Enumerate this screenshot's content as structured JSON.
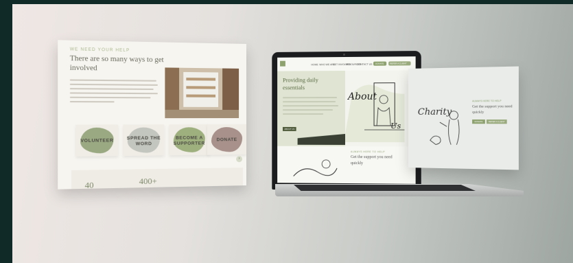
{
  "left_panel": {
    "kicker": "WE NEED YOUR HELP",
    "heading_line1": "There are so many ways to get",
    "heading_line2": "involved",
    "tiles": [
      {
        "label": "VOLUNTEER",
        "color": "#9aa982"
      },
      {
        "label": "SPREAD THE WORD",
        "color": "#c3c6bf"
      },
      {
        "label": "BECOME A SUPPORTER",
        "color": "#9fb07f"
      },
      {
        "label": "DONATE",
        "color": "#a8908b"
      }
    ],
    "stats": [
      "40",
      "400+"
    ]
  },
  "laptop": {
    "nav_items": [
      "HOME",
      "WHO WE ARE",
      "GET INVOLVED",
      "RESOURCES",
      "CONTACT US"
    ],
    "cta1": "DONATE",
    "cta2": "REFER A CLIENT",
    "hero_title_line1": "Providing daily",
    "hero_title_line2": "essentials",
    "hero_button": "ABOUT US",
    "about_word": "About",
    "us_word": "Us",
    "kicker": "ALWAYS HERE TO HELP",
    "subhead_line1": "Get the support you need",
    "subhead_line2": "quickly",
    "brand_green": "#8ea26f"
  },
  "right_panel": {
    "charity_word": "Charity",
    "kicker": "ALWAYS HERE TO HELP",
    "subhead_line1": "Get the support you need",
    "subhead_line2": "quickly",
    "btn1": "DONATE",
    "btn2": "REFER A CLIENT"
  }
}
